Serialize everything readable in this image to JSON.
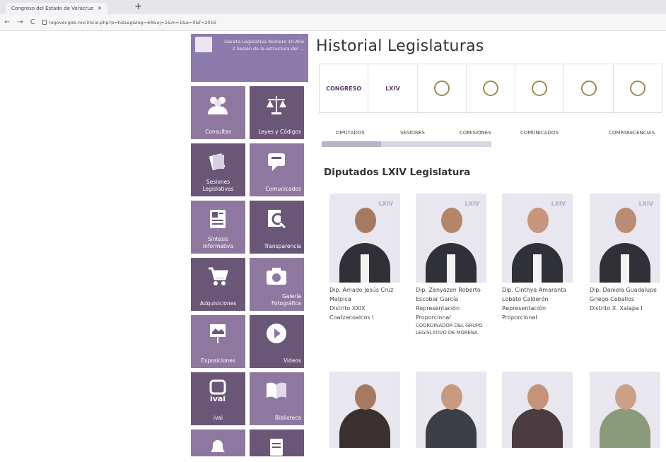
{
  "browser": {
    "tab_title": "Congreso del Estado de Veracruz",
    "tab_close": "×",
    "new_tab": "+",
    "back": "←",
    "forward": "→",
    "reload": "C",
    "url": "legover.gob.mx/inicio.php?p=hisLeg&leg=64&ej=1&m=1&a=0&f=2016"
  },
  "header_box": {
    "text": "Gaceta Legislativa Número 10 Año 2 Sesión de la estructura del ..."
  },
  "menu": [
    {
      "label": "Consultas",
      "icon": "people-icon"
    },
    {
      "label": "Leyes y Códigos",
      "icon": "scales-icon"
    },
    {
      "label": "Sesiones Legislativas",
      "icon": "book-stack-icon"
    },
    {
      "label": "Comunicados",
      "icon": "speech-icon"
    },
    {
      "label": "Síntesis Informativa",
      "icon": "newspaper-icon"
    },
    {
      "label": "Transparencia",
      "icon": "magnifier-icon"
    },
    {
      "label": "Adquisiciones",
      "icon": "cart-icon"
    },
    {
      "label": "Galería Fotográfica",
      "icon": "camera-icon"
    },
    {
      "label": "Exposiciones",
      "icon": "easel-icon"
    },
    {
      "label": "Videos",
      "icon": "play-icon"
    },
    {
      "label": "ivai",
      "icon": "ivai-logo-icon"
    },
    {
      "label": "Biblioteca",
      "icon": "open-book-icon"
    },
    {
      "label": "",
      "icon": "bell-icon"
    },
    {
      "label": "",
      "icon": "document-icon"
    }
  ],
  "main": {
    "title": "Historial Legislaturas",
    "logos": [
      {
        "text": "CONGRESO",
        "icon": "congreso-logo-icon"
      },
      {
        "text": "LXIV",
        "icon": "lxiv-logo-icon"
      },
      {
        "text": "",
        "icon": "seal-icon"
      },
      {
        "text": "",
        "icon": "seal-icon"
      },
      {
        "text": "",
        "icon": "seal-icon"
      },
      {
        "text": "",
        "icon": "seal-icon"
      },
      {
        "text": "",
        "icon": "seal-icon"
      }
    ],
    "tabs": [
      "DIPUTADOS",
      "SESIONES",
      "COMISIONES",
      "COMUNICADOS",
      "COMPARECENCIAS"
    ],
    "subtitle": "Diputados LXIV Legislatura",
    "deputies": [
      {
        "name": "Dip. Amado Jesús Cruz Malpica",
        "district": "Distrito XXIX Coatzacoalcos I",
        "role": ""
      },
      {
        "name": "Dip. Zenyazen Roberto Escobar García",
        "district": "Representación Proporcional",
        "role": "COORDINADOR DEL GRUPO LEGISLATIVO DE MORENA"
      },
      {
        "name": "Dip. Cinthya Amaranta Lobato Calderón",
        "district": "Representación Proporcional",
        "role": ""
      },
      {
        "name": "Dip. Daniela Guadalupe Griego Ceballos",
        "district": "Distrito X. Xalapa I",
        "role": ""
      }
    ]
  },
  "colors": {
    "tile": "#8f789f",
    "tile_dark": "#6a5677",
    "header": "#8d7bab"
  }
}
